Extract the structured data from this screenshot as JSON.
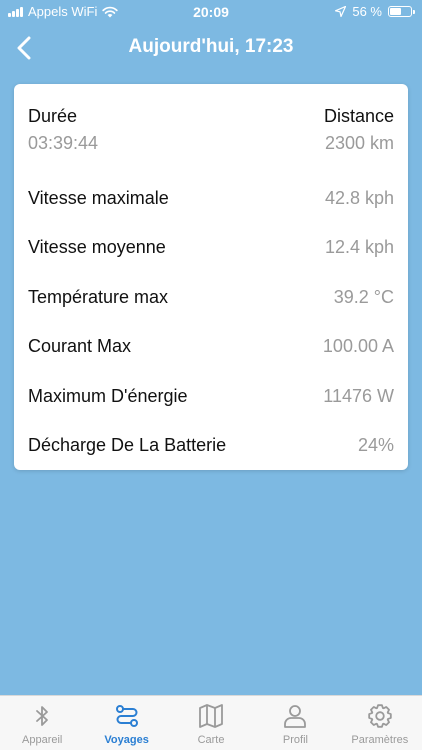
{
  "status_bar": {
    "carrier": "Appels WiFi",
    "time": "20:09",
    "battery_percent": "56 %",
    "battery_level": 0.56
  },
  "nav": {
    "title": "Aujourd'hui, 17:23"
  },
  "trip": {
    "duration_label": "Durée",
    "duration_value": "03:39:44",
    "distance_label": "Distance",
    "distance_value": "2300 km",
    "stats": [
      {
        "label": "Vitesse maximale",
        "value": "42.8 kph"
      },
      {
        "label": "Vitesse moyenne",
        "value": "12.4 kph"
      },
      {
        "label": "Température max",
        "value": "39.2 °C"
      },
      {
        "label": "Courant Max",
        "value": "100.00 A"
      },
      {
        "label": "Maximum D'énergie",
        "value": "11476 W"
      },
      {
        "label": "Décharge De La Batterie",
        "value": "24%"
      }
    ]
  },
  "tabs": [
    {
      "label": "Appareil",
      "icon": "bluetooth-icon",
      "active": false
    },
    {
      "label": "Voyages",
      "icon": "route-icon",
      "active": true
    },
    {
      "label": "Carte",
      "icon": "map-icon",
      "active": false
    },
    {
      "label": "Profil",
      "icon": "person-icon",
      "active": false
    },
    {
      "label": "Paramètres",
      "icon": "gear-icon",
      "active": false
    }
  ],
  "colors": {
    "background": "#7db9e2",
    "accent": "#2b7fd3",
    "inactive": "#9a9a9a"
  }
}
